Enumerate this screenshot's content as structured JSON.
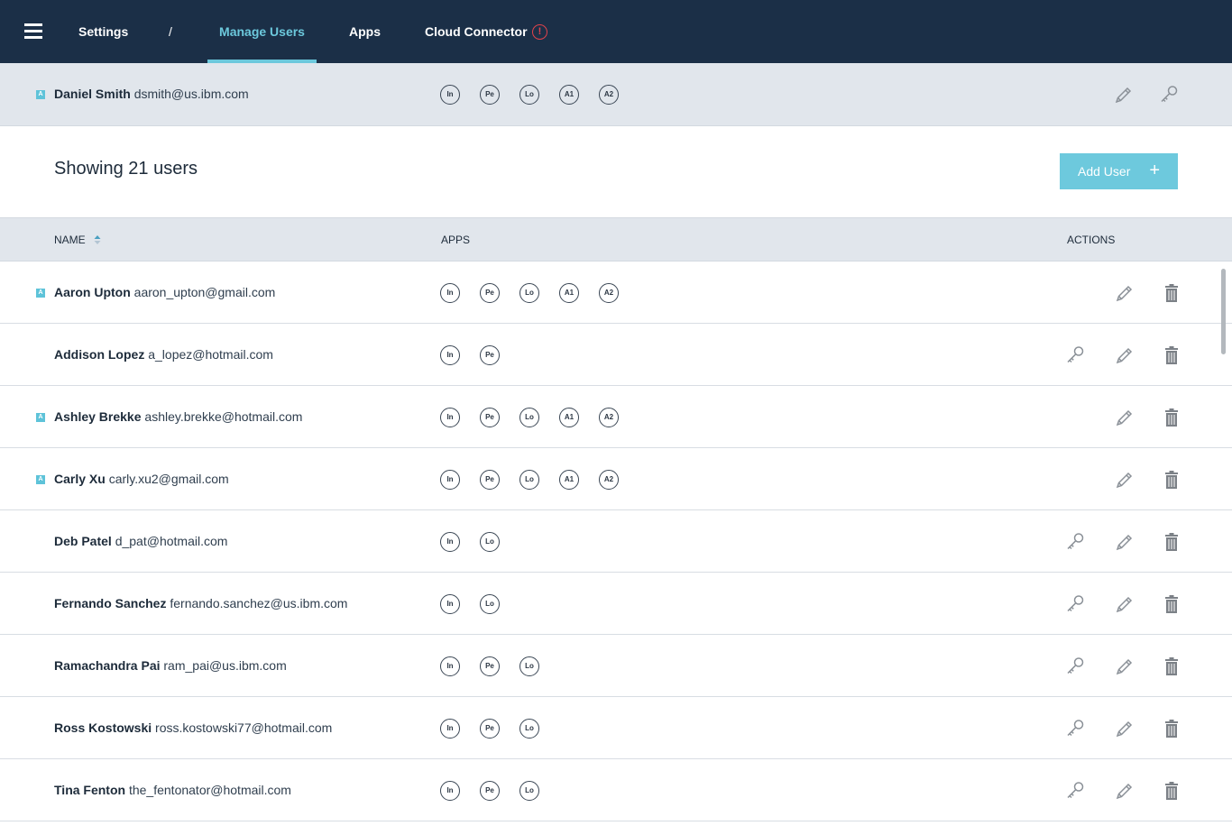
{
  "nav": {
    "settings": "Settings",
    "separator": "/",
    "manage_users": "Manage Users",
    "apps": "Apps",
    "cloud_connector": "Cloud Connector",
    "alert_symbol": "!"
  },
  "current_user": {
    "admin": true,
    "name": "Daniel Smith",
    "email": "dsmith@us.ibm.com",
    "apps": [
      "In",
      "Pe",
      "Lo",
      "A1",
      "A2"
    ]
  },
  "summary": {
    "title": "Showing 21 users",
    "add_user_label": "Add User",
    "add_user_icon": "+"
  },
  "table": {
    "headers": {
      "name": "NAME",
      "apps": "APPS",
      "actions": "ACTIONS"
    },
    "admin_badge": "A",
    "rows": [
      {
        "admin": true,
        "name": "Aaron Upton",
        "email": "aaron_upton@gmail.com",
        "apps": [
          "In",
          "Pe",
          "Lo",
          "A1",
          "A2"
        ],
        "key": false
      },
      {
        "admin": false,
        "name": "Addison Lopez",
        "email": "a_lopez@hotmail.com",
        "apps": [
          "In",
          "Pe"
        ],
        "key": true
      },
      {
        "admin": true,
        "name": "Ashley Brekke",
        "email": "ashley.brekke@hotmail.com",
        "apps": [
          "In",
          "Pe",
          "Lo",
          "A1",
          "A2"
        ],
        "key": false
      },
      {
        "admin": true,
        "name": "Carly Xu",
        "email": "carly.xu2@gmail.com",
        "apps": [
          "In",
          "Pe",
          "Lo",
          "A1",
          "A2"
        ],
        "key": false
      },
      {
        "admin": false,
        "name": "Deb Patel",
        "email": "d_pat@hotmail.com",
        "apps": [
          "In",
          "Lo"
        ],
        "key": true
      },
      {
        "admin": false,
        "name": "Fernando Sanchez",
        "email": "fernando.sanchez@us.ibm.com",
        "apps": [
          "In",
          "Lo"
        ],
        "key": true
      },
      {
        "admin": false,
        "name": "Ramachandra Pai",
        "email": "ram_pai@us.ibm.com",
        "apps": [
          "In",
          "Pe",
          "Lo"
        ],
        "key": true
      },
      {
        "admin": false,
        "name": "Ross Kostowski",
        "email": "ross.kostowski77@hotmail.com",
        "apps": [
          "In",
          "Pe",
          "Lo"
        ],
        "key": true
      },
      {
        "admin": false,
        "name": "Tina Fenton",
        "email": "the_fentonator@hotmail.com",
        "apps": [
          "In",
          "Pe",
          "Lo"
        ],
        "key": true
      }
    ]
  },
  "colors": {
    "nav_bg": "#1b2f47",
    "accent": "#6cc8dc",
    "alert": "#e2434b",
    "band_bg": "#e1e6ec"
  },
  "icons": {
    "menu": "hamburger-menu-icon",
    "alert": "alert-circle-icon",
    "edit": "pencil-icon",
    "key": "key-icon",
    "delete": "trash-icon",
    "sort": "sort-icon",
    "add": "plus-icon"
  }
}
